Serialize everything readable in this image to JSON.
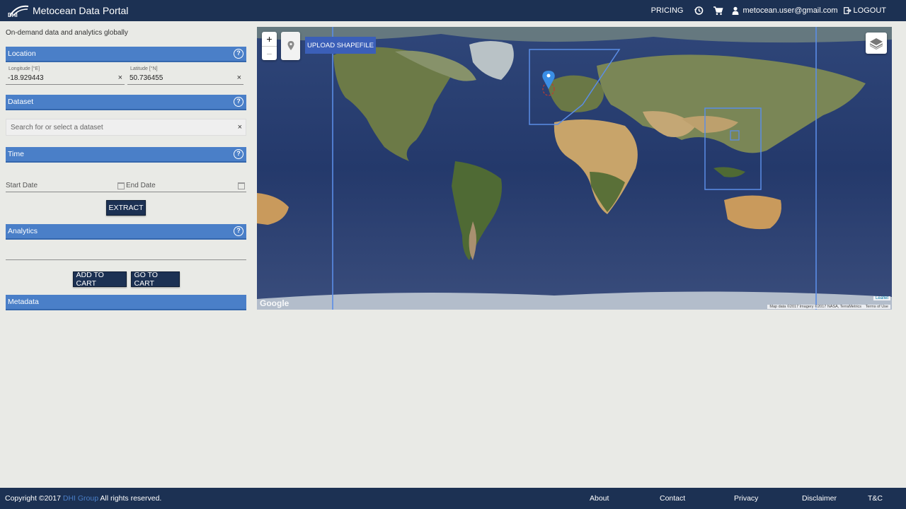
{
  "header": {
    "logo_text": "DHI",
    "app_title": "Metocean Data Portal",
    "pricing": "PRICING",
    "history_icon": "history-icon",
    "cart_icon": "cart-icon",
    "user_icon": "user-icon",
    "user_email": "metocean.user@gmail.com",
    "logout": "LOGOUT"
  },
  "sidebar": {
    "tagline": "On-demand data and analytics globally",
    "location": {
      "title": "Location",
      "longitude_label": "Longitude [°E]",
      "longitude_value": "-18.929443",
      "latitude_label": "Latitude [°N]",
      "latitude_value": "50.736455",
      "clear_glyph": "×"
    },
    "dataset": {
      "title": "Dataset",
      "placeholder": "Search for or select a dataset",
      "clear_glyph": "×"
    },
    "time": {
      "title": "Time",
      "start_placeholder": "Start Date",
      "end_placeholder": "End Date",
      "extract_label": "EXTRACT"
    },
    "analytics": {
      "title": "Analytics"
    },
    "cart": {
      "add_label": "ADD TO CART",
      "go_label": "GO TO CART"
    },
    "metadata": {
      "title": "Metadata"
    },
    "help_glyph": "?"
  },
  "map": {
    "zoom_in": "+",
    "zoom_out": "−",
    "upload_label": "UPLOAD SHAPEFILE",
    "google_label": "Google",
    "leaflet_label": "Leaflet",
    "attribution": "Map data ©2017 Imagery ©2017 NASA, TerraMetrics",
    "terms": "Terms of Use"
  },
  "footer": {
    "copyright_prefix": "Copyright ©2017",
    "company_link": "DHI Group",
    "copyright_suffix": "All rights reserved.",
    "links": [
      "About",
      "Contact",
      "Privacy",
      "Disclaimer",
      "T&C"
    ]
  },
  "colors": {
    "navbar": "#1c3153",
    "section_header": "#4a7fc8",
    "ocean": "#2a3d6e",
    "land": "#6a7a45",
    "desert": "#c8a46a",
    "selection_outline": "#5b8de6",
    "marker": "#3a8ee6"
  }
}
